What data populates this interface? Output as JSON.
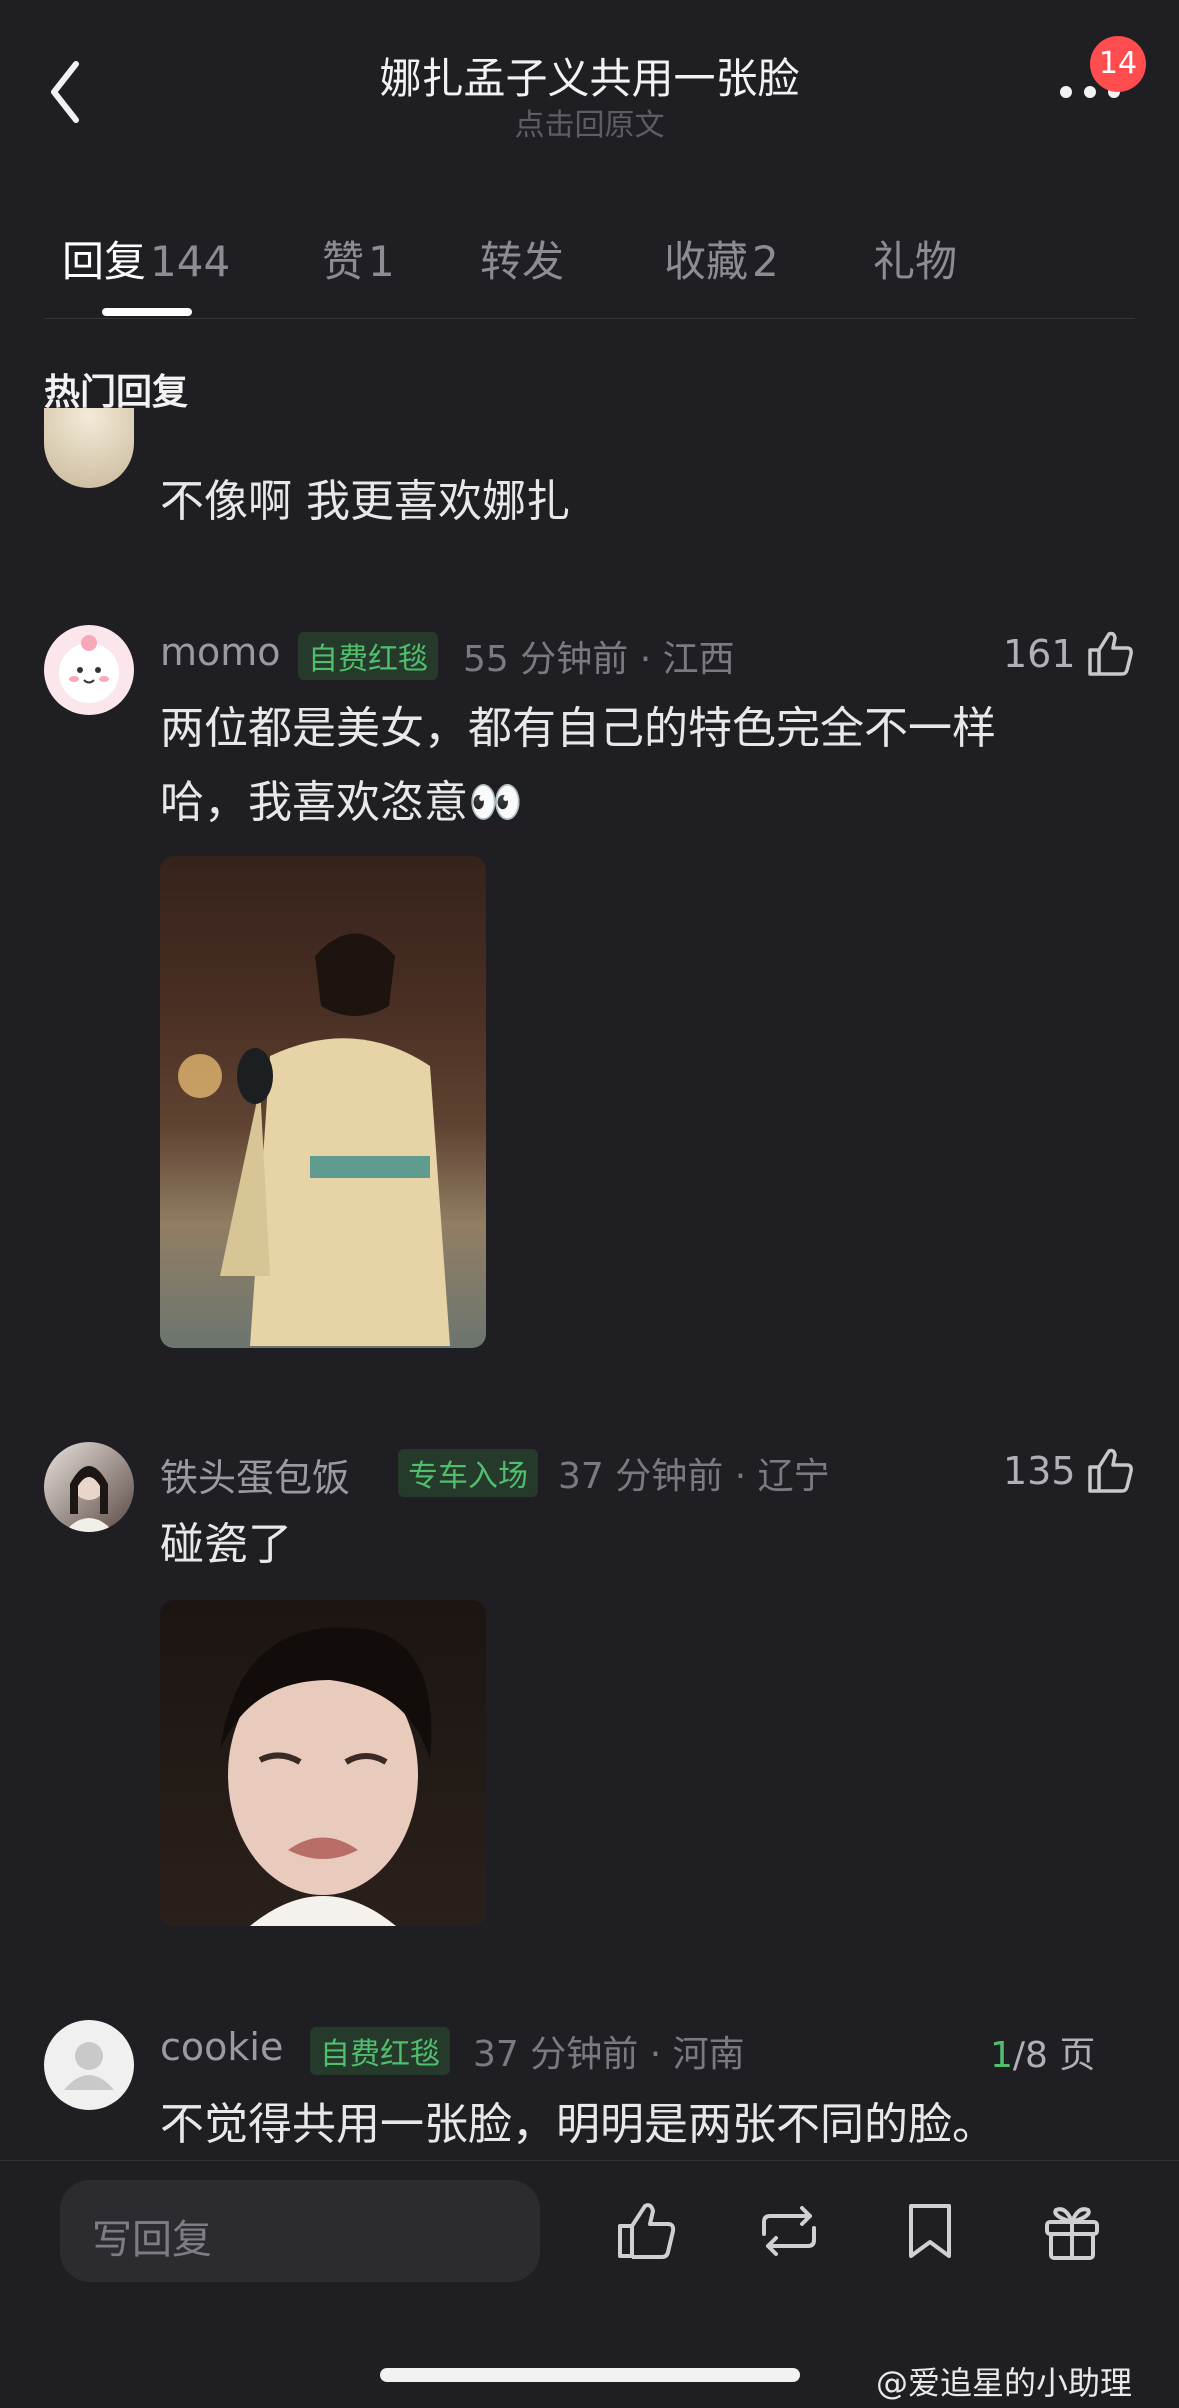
{
  "header": {
    "title": "娜扎孟子义共用一张脸",
    "subtitle": "点击回原文",
    "badge": "14"
  },
  "tabs": [
    {
      "label": "回复",
      "count": "144",
      "active": true
    },
    {
      "label": "赞",
      "count": "1"
    },
    {
      "label": "转发",
      "count": ""
    },
    {
      "label": "收藏",
      "count": "2"
    },
    {
      "label": "礼物",
      "count": ""
    }
  ],
  "section_title": "热门回复",
  "comments": [
    {
      "text": "不像啊 我更喜欢娜扎"
    },
    {
      "user": "momo",
      "tag": "自费红毯",
      "meta": "55 分钟前 · 江西",
      "likes": "161",
      "text_line1": "两位都是美女，都有自己的特色完全不一样",
      "text_line2": "哈，我喜欢恣意👀"
    },
    {
      "user": "铁头蛋包饭",
      "tag": "专车入场",
      "meta": "37 分钟前 · 辽宁",
      "likes": "135",
      "text": "碰瓷了"
    },
    {
      "user": "cookie",
      "tag": "自费红毯",
      "meta": "37 分钟前 · 河南",
      "text": "不觉得共用一张脸，明明是两张不同的脸。"
    }
  ],
  "pager": {
    "current": "1",
    "total": "/8 页"
  },
  "bottom": {
    "reply_placeholder": "写回复"
  },
  "watermark": "@爱追星的小助理",
  "colors": {
    "background": "#1f1f23",
    "accent_green": "#4fbf6e",
    "badge_red": "#ff4d4f"
  }
}
